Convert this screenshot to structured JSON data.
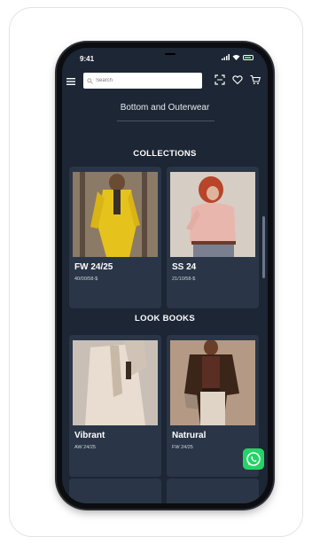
{
  "status": {
    "time": "9:41"
  },
  "search": {
    "placeholder": "Search"
  },
  "page": {
    "title": "Bottom and Outerwear"
  },
  "sections": {
    "collections": "COLLECTIONS",
    "lookbooks": "LOOK BOOKS"
  },
  "collections": [
    {
      "name": "FW 24/25",
      "code": "40/00/58-$"
    },
    {
      "name": "SS 24",
      "code": "21/10/58-$"
    }
  ],
  "lookbooks": [
    {
      "name": "Vibrant",
      "code": "AW 24/25"
    },
    {
      "name": "Natrural",
      "code": "FW 24/25"
    }
  ],
  "icons": {
    "menu": "menu-icon",
    "search": "search-icon",
    "scan": "scan-icon",
    "wishlist": "heart-icon",
    "cart": "cart-icon",
    "whatsapp": "whatsapp-icon"
  },
  "colors": {
    "screen_bg": "#1c2634",
    "card_bg": "#2a3647",
    "whatsapp": "#25d366"
  }
}
